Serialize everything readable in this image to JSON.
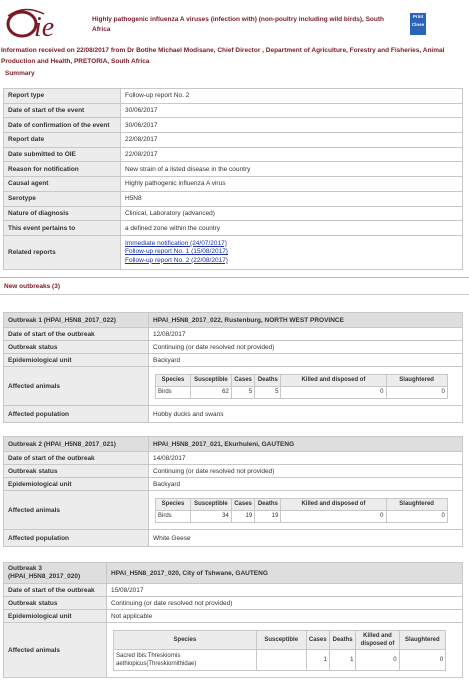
{
  "header": {
    "logo_text": "OIE",
    "title": "Highly pathogenic influenza A viruses (infection with) (non-poultry including wild birds), South Africa",
    "print_label": "Print",
    "close_label": "Close"
  },
  "info": "Information received on 22/08/2017 from Dr Botlhe Michael Modisane, Chief Director , Department of Agriculture, Forestry and Fisheries, Animal Production and Health, PRETORIA, South Africa",
  "summary_heading": "Summary",
  "summary": [
    {
      "k": "Report type",
      "v": "Follow-up report No. 2"
    },
    {
      "k": "Date of start of the event",
      "v": "30/06/2017"
    },
    {
      "k": "Date of confirmation of the event",
      "v": "30/06/2017"
    },
    {
      "k": "Report date",
      "v": "22/08/2017"
    },
    {
      "k": "Date submitted to OIE",
      "v": "22/08/2017"
    },
    {
      "k": "Reason for notification",
      "v": "New strain of a listed disease in the country"
    },
    {
      "k": "Causal agent",
      "v": "Highly pathogenic influenza A virus"
    },
    {
      "k": "Serotype",
      "v": "H5N8"
    },
    {
      "k": "Nature of diagnosis",
      "v": "Clinical, Laboratory (advanced)"
    },
    {
      "k": "This event pertains to",
      "v": "a defined zone within the country"
    }
  ],
  "related": {
    "label": "Related reports",
    "links": [
      "Immediate notification (24/07/2017)",
      "Follow-up report No. 1 (15/08/2017)",
      "Follow-up report No. 2 (22/08/2017)"
    ]
  },
  "new_outbreaks_heading": "New outbreaks (3)",
  "labels": {
    "start": "Date of start of the outbreak",
    "status": "Outbreak status",
    "epi": "Epidemiological unit",
    "animals": "Affected animals",
    "population": "Affected population",
    "col_species": "Species",
    "col_susceptible": "Susceptible",
    "col_cases": "Cases",
    "col_deaths": "Deaths",
    "col_killed": "Killed and disposed of",
    "col_slaughtered": "Slaughtered"
  },
  "outbreaks": [
    {
      "name": "Outbreak 1 (HPAI_H5N8_2017_022)",
      "location": "HPAI_H5N8_2017_022, Rustenburg, NORTH WEST PROVINCE",
      "start": "12/08/2017",
      "status": "Continuing (or date resolved not provided)",
      "epi": "Backyard",
      "species": "Birds",
      "susceptible": "62",
      "cases": "5",
      "deaths": "5",
      "killed": "0",
      "slaughtered": "0",
      "population": "Hobby ducks and swans"
    },
    {
      "name": "Outbreak 2 (HPAI_H5N8_2017_021)",
      "location": "HPAI_H5N8_2017_021, Ekurhuleni, GAUTENG",
      "start": "14/08/2017",
      "status": "Continuing (or date resolved not provided)",
      "epi": "Backyard",
      "species": "Birds",
      "susceptible": "34",
      "cases": "19",
      "deaths": "19",
      "killed": "0",
      "slaughtered": "0",
      "population": "White Geese"
    },
    {
      "name": "Outbreak 3 (HPAI_H5N8_2017_020)",
      "location": "HPAI_H5N8_2017_020, City of Tshwane, GAUTENG",
      "start": "15/08/2017",
      "status": "Continuing (or date resolved not provided)",
      "epi": "Not applicable",
      "species": "Sacred Ibis:Threskiornis aethiopicus(Threskiornithidae)",
      "susceptible": "",
      "cases": "1",
      "deaths": "1",
      "killed": "0",
      "slaughtered": "0"
    }
  ],
  "colors": {
    "maroon": "#7a1a26",
    "link": "#1a2fb0",
    "header_gray": "#ececec",
    "print_blue": "#2a64b8"
  }
}
